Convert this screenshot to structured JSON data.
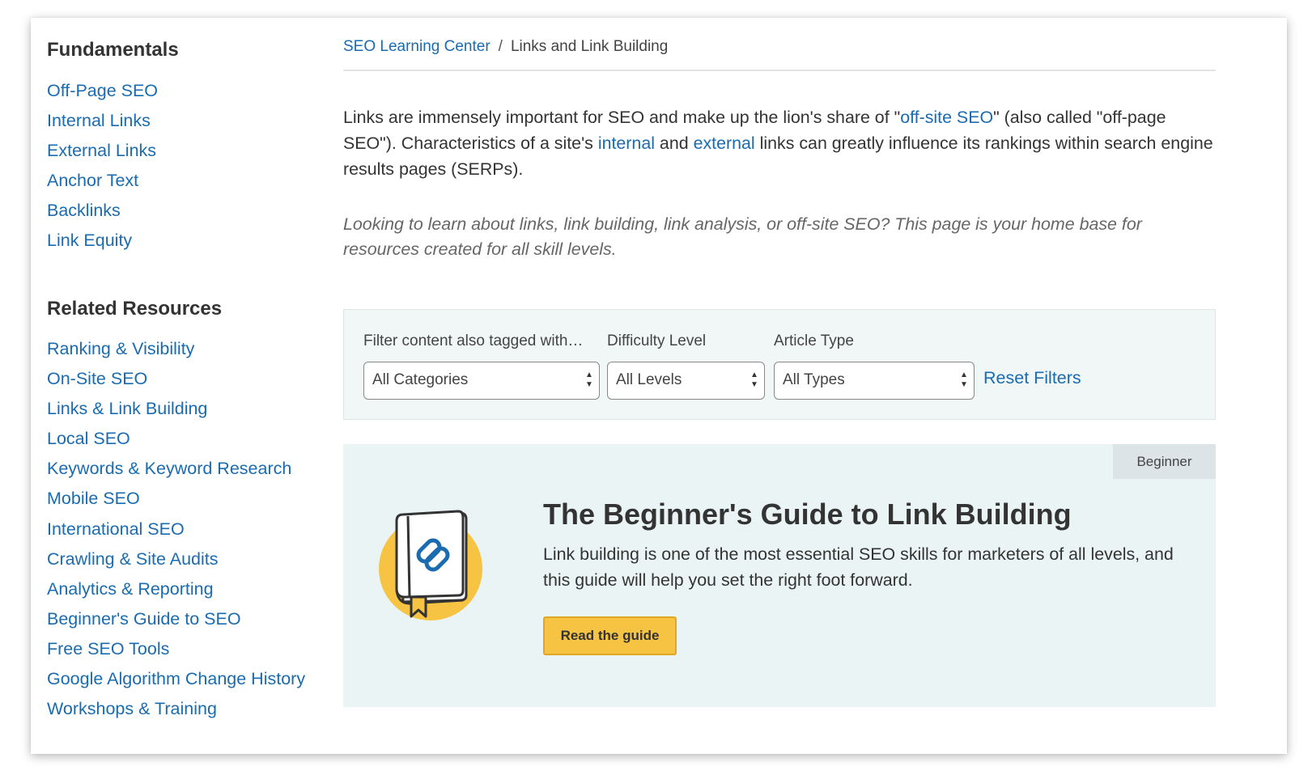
{
  "sidebar": {
    "fundamentals_heading": "Fundamentals",
    "fundamentals": [
      {
        "label": "Off-Page SEO"
      },
      {
        "label": "Internal Links"
      },
      {
        "label": "External Links"
      },
      {
        "label": "Anchor Text"
      },
      {
        "label": "Backlinks"
      },
      {
        "label": "Link Equity"
      }
    ],
    "related_heading": "Related Resources",
    "related": [
      {
        "label": "Ranking & Visibility"
      },
      {
        "label": "On-Site SEO"
      },
      {
        "label": "Links & Link Building"
      },
      {
        "label": "Local SEO"
      },
      {
        "label": "Keywords & Keyword Research"
      },
      {
        "label": "Mobile SEO"
      },
      {
        "label": "International SEO"
      },
      {
        "label": "Crawling & Site Audits"
      },
      {
        "label": "Analytics & Reporting"
      },
      {
        "label": "Beginner's Guide to SEO"
      },
      {
        "label": "Free SEO Tools"
      },
      {
        "label": "Google Algorithm Change History"
      },
      {
        "label": "Workshops & Training"
      }
    ]
  },
  "breadcrumb": {
    "root": "SEO Learning Center",
    "separator": "/",
    "current": "Links and Link Building"
  },
  "intro": {
    "part1": "Links are immensely important for SEO and make up the lion's share of \"",
    "link_offsite": "off-site SEO",
    "part2": "\" (also called \"off-page SEO\"). Characteristics of a site's ",
    "link_internal": "internal",
    "part3": " and ",
    "link_external": "external",
    "part4": " links can greatly influence its rankings within search engine results pages (SERPs)."
  },
  "tagline": "Looking to learn about links, link building, link analysis, or off-site SEO? This page is your home base for resources created for all skill levels.",
  "filters": {
    "category_label": "Filter content also tagged with…",
    "category_value": "All Categories",
    "difficulty_label": "Difficulty Level",
    "difficulty_value": "All Levels",
    "type_label": "Article Type",
    "type_value": "All Types",
    "reset_label": "Reset Filters"
  },
  "guide": {
    "badge": "Beginner",
    "title": "The Beginner's Guide to Link Building",
    "description": "Link building is one of the most essential SEO skills for marketers of all levels, and this guide will help you set the right foot forward.",
    "button_label": "Read the guide",
    "icon": "book-link-icon"
  },
  "colors": {
    "link": "#1a6bb0",
    "accent_button": "#f6c342",
    "panel_bg": "#f1f7f7",
    "card_bg": "#eaf4f4",
    "badge_bg": "#dce4e7"
  }
}
